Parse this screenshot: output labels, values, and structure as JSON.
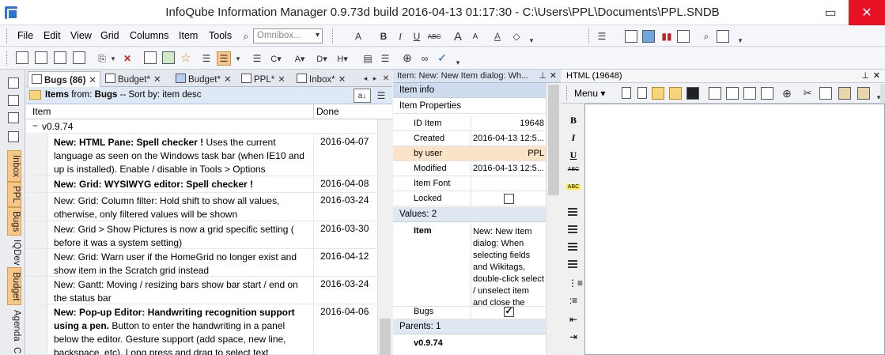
{
  "window": {
    "title": "InfoQube Information Manager 0.9.73d  build 2016-04-13 01:17:30 - C:\\Users\\PPL\\Documents\\PPL.SNDB"
  },
  "menu": {
    "items": [
      "File",
      "Edit",
      "View",
      "Grid",
      "Columns",
      "Item",
      "Tools"
    ],
    "omnibox_placeholder": "Omnibox..."
  },
  "left_tabs": [
    "Inbox",
    "PPL",
    "Bugs",
    "IQDev",
    "Budget",
    "Agenda",
    "C"
  ],
  "grid_panel": {
    "tabs": [
      {
        "label": "Bugs (86)",
        "close": "✕"
      },
      {
        "label": "Budget*",
        "close": "✕"
      },
      {
        "label": "Budget*",
        "close": "✕"
      },
      {
        "label": "PPL*",
        "close": "✕"
      },
      {
        "label": "Inbox*",
        "close": "✕"
      }
    ],
    "header": {
      "prefix": "Items",
      "from_label": "from:",
      "source": "Bugs",
      "sort_label": "-- Sort by:",
      "sort": "item desc"
    },
    "columns": [
      "Item",
      "Done"
    ],
    "group": "v0.9.74",
    "rows": [
      {
        "bold": "New: HTML Pane: Spell checker !",
        "text": " Uses the current language as seen on the Windows task bar (when IE10 and up is installed). Enable / disable in Tools > Options",
        "date": "2016-04-07"
      },
      {
        "bold": "New: Grid: WYSIWYG editor: Spell checker !",
        "text": "",
        "date": "2016-04-08"
      },
      {
        "bold": "",
        "text": "New: Grid: Column filter: Hold shift to show all values, otherwise, only filtered values will be shown",
        "date": "2016-03-24"
      },
      {
        "bold": "",
        "text": "New: Grid > Show Pictures is now a grid specific setting ( before it was a system setting)",
        "date": "2016-03-30"
      },
      {
        "bold": "",
        "text": "New: Grid: Warn user if the HomeGrid no longer exist and show item in the Scratch grid instead",
        "date": "2016-04-12"
      },
      {
        "bold": "",
        "text": "New: Gantt: Moving / resizing bars show bar start / end on the status bar",
        "date": "2016-03-24"
      },
      {
        "bold": "New: Pop-up Editor: Handwriting recognition support using a pen.",
        "text": " Button to enter the handwriting in a panel below the editor. Gesture support (add space, new line, backspace, etc). Long press and drag to select text",
        "date": "2016-04-06"
      }
    ]
  },
  "props_panel": {
    "title": "Item: New: New Item dialog: Wh...",
    "section_info": "Item info",
    "section_props": "Item Properties",
    "props": [
      {
        "key": "ID Item",
        "value": "19648"
      },
      {
        "key": "Created",
        "value": "2016-04-13 12:5..."
      },
      {
        "key": "by user",
        "value": "PPL"
      },
      {
        "key": "Modified",
        "value": "2016-04-13 12:5..."
      },
      {
        "key": "Item Font",
        "value": ""
      },
      {
        "key": "Locked",
        "value": ""
      }
    ],
    "values_label": "Values: 2",
    "item_key": "Item",
    "item_value": "New: New Item dialog: When selecting fields and Wikitags, double-click select / unselect item and close the",
    "bugs_key": "Bugs",
    "parents_label": "Parents: 1",
    "parent": "v0.9.74"
  },
  "html_panel": {
    "title": "HTML (19648)",
    "menu_label": "Menu"
  }
}
